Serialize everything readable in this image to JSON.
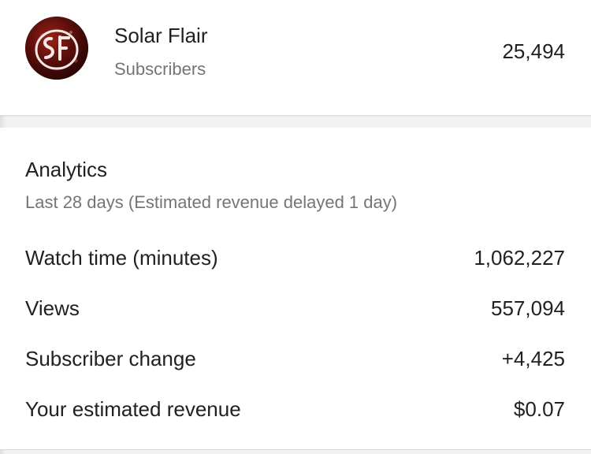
{
  "channel": {
    "name": "Solar Flair",
    "subscribers_label": "Subscribers",
    "subscribers_count": "25,494",
    "avatar_logo_text": "SF"
  },
  "analytics": {
    "title": "Analytics",
    "subtitle": "Last 28 days (Estimated revenue delayed 1 day)",
    "metrics": [
      {
        "label": "Watch time (minutes)",
        "value": "1,062,227"
      },
      {
        "label": "Views",
        "value": "557,094"
      },
      {
        "label": "Subscriber change",
        "value": "+4,425"
      },
      {
        "label": "Your estimated revenue",
        "value": "$0.07"
      }
    ]
  },
  "colors": {
    "avatar_background": "#6b1410",
    "text_primary": "#212121",
    "text_secondary": "#757575",
    "page_background": "#f2f2f2"
  }
}
